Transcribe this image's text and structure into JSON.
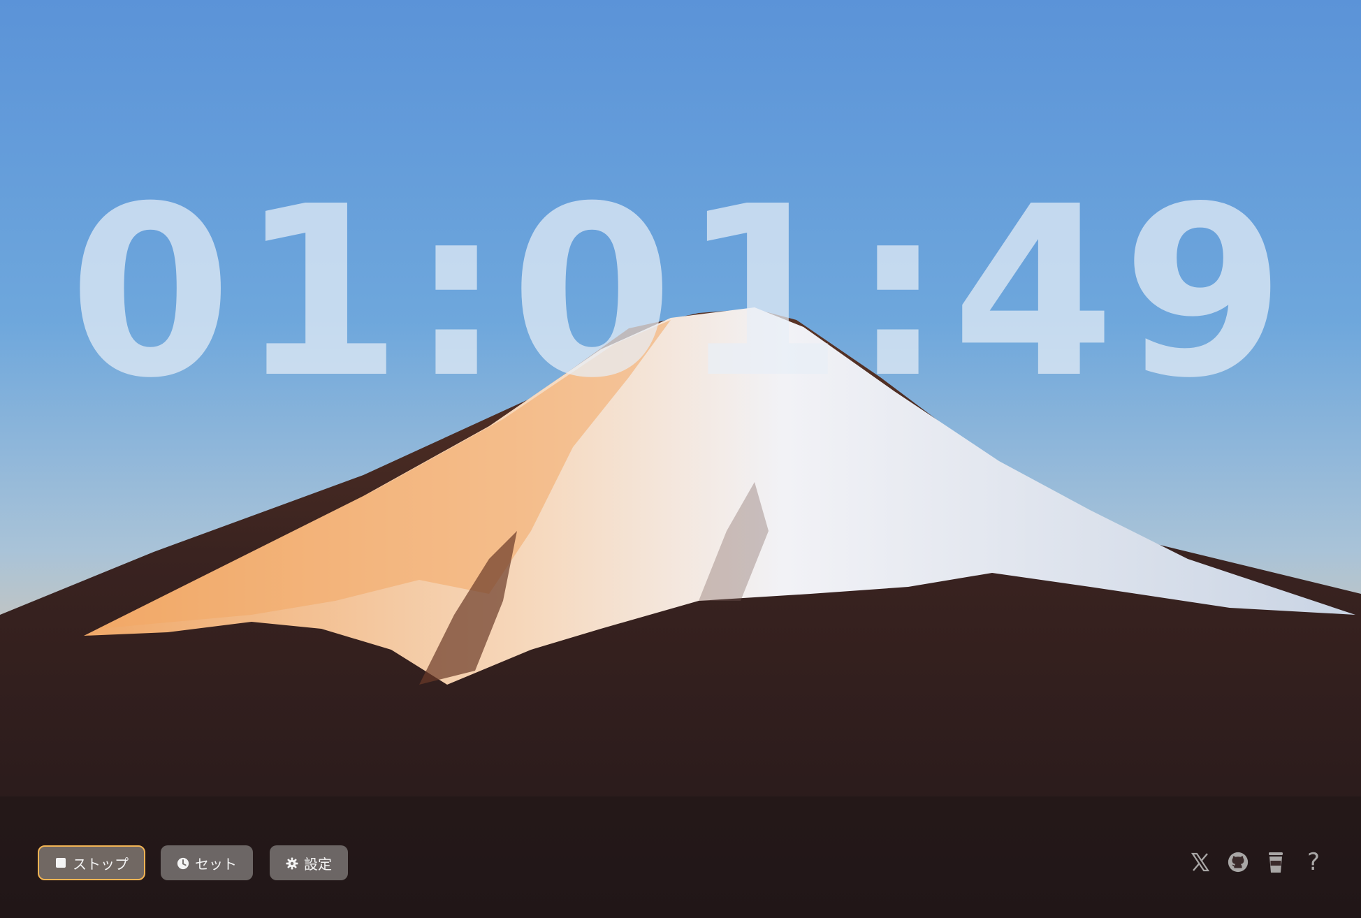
{
  "timer": {
    "display": "01:01:49"
  },
  "controls": {
    "stop_label": "ストップ",
    "set_label": "セット",
    "settings_label": "設定"
  },
  "icons": {
    "stop": "stop-square-icon",
    "set": "clock-icon",
    "settings": "gear-icon",
    "x": "x-logo-icon",
    "github": "github-icon",
    "coffee": "coffee-cup-icon",
    "help": "question-mark-icon"
  },
  "help_glyph": "?",
  "colors": {
    "accent_border": "#f2b454",
    "button_bg": "#767270",
    "icon_gray": "#a9a7a6"
  }
}
